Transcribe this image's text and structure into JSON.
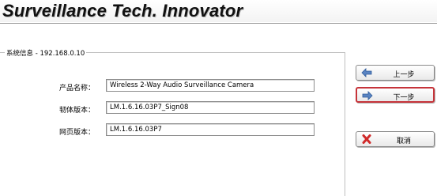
{
  "header": {
    "brand": "Surveillance Tech. Innovator"
  },
  "system_info": {
    "legend": "系统信息 - 192.168.0.10",
    "fields": [
      {
        "label": "产品名称：",
        "value": "Wireless 2-Way Audio Surveillance Camera"
      },
      {
        "label": "韧体版本：",
        "value": "LM.1.6.16.03P7_Sign08"
      },
      {
        "label": "网页版本：",
        "value": "LM.1.6.16.03P7"
      }
    ]
  },
  "buttons": {
    "prev": {
      "label": "上一步",
      "icon": "arrow-left-icon"
    },
    "next": {
      "label": "下一步",
      "icon": "arrow-right-icon"
    },
    "cancel": {
      "label": "取消",
      "icon": "x-icon"
    }
  },
  "colors": {
    "icon_blue": "#5a84c2",
    "icon_red": "#d02a2a",
    "focus_border": "#c6343a"
  }
}
